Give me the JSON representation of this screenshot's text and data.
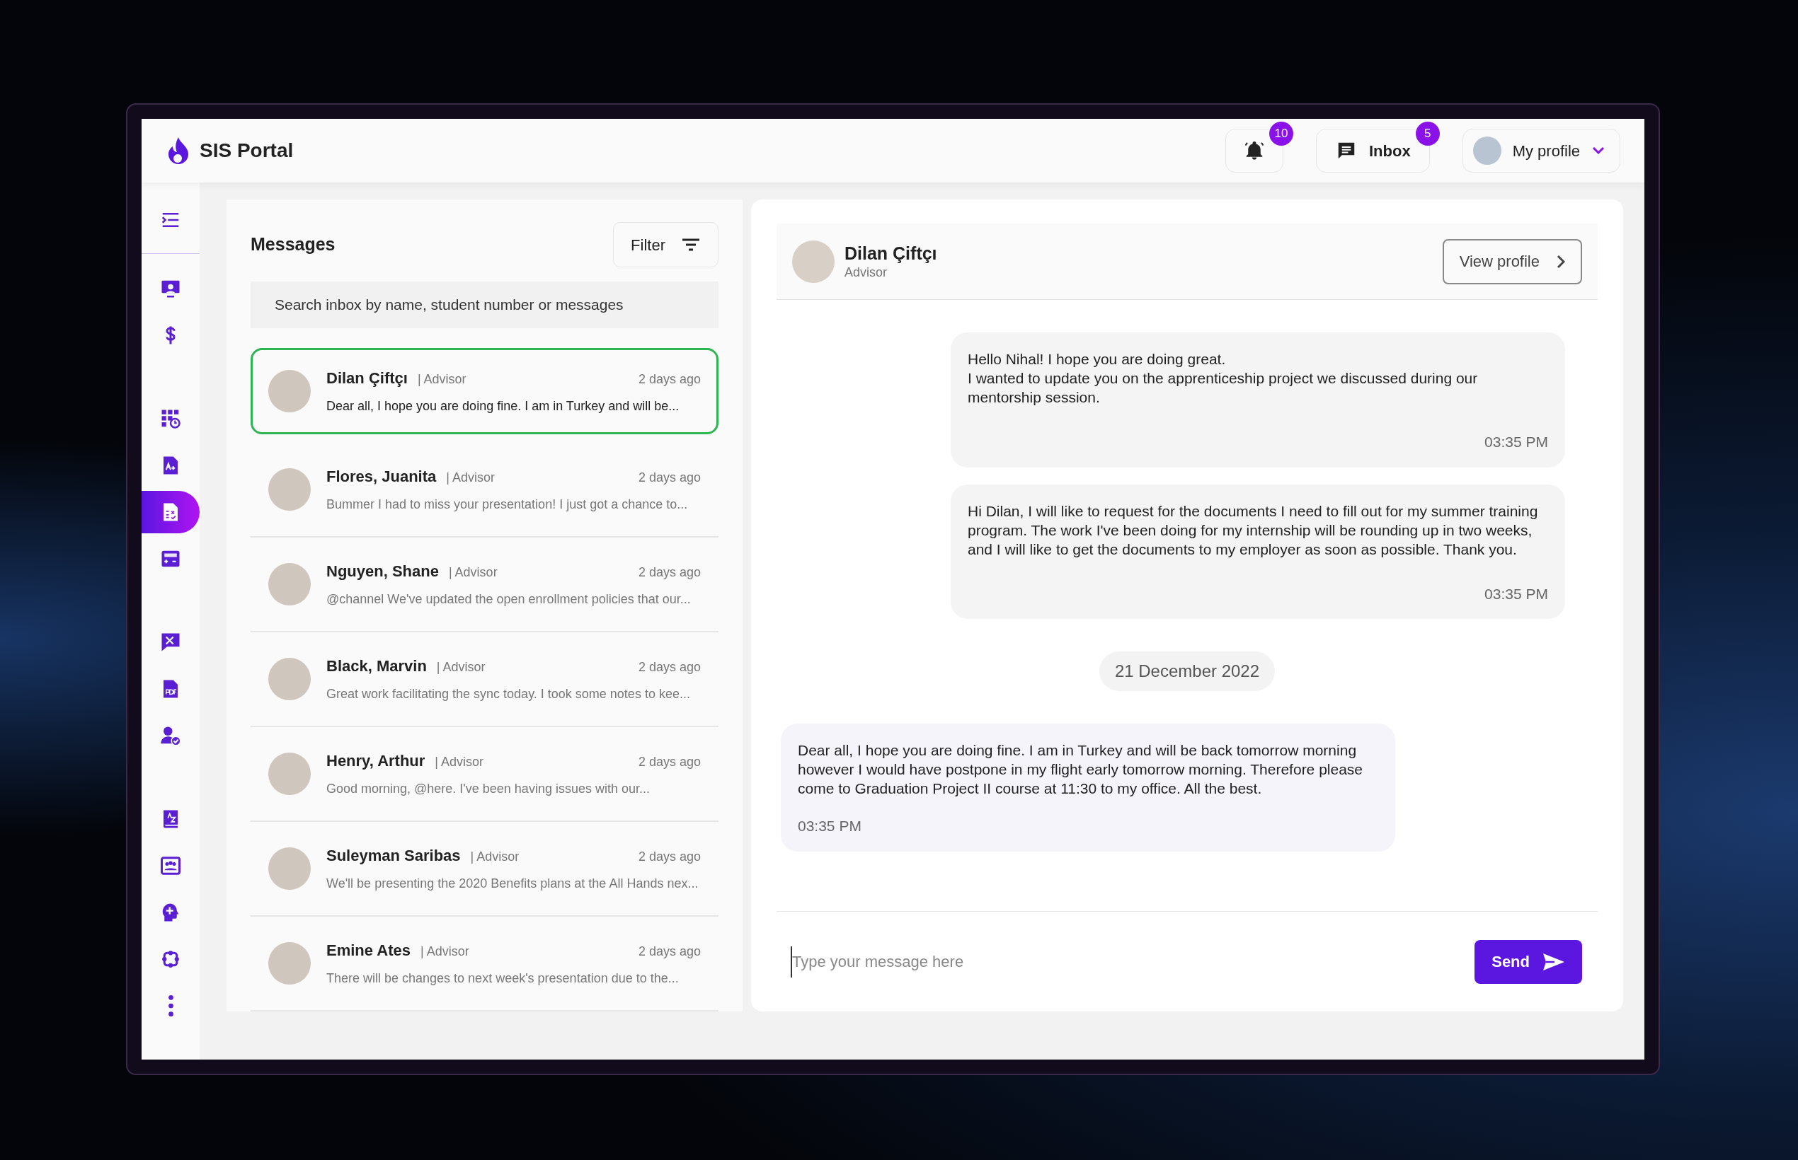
{
  "header": {
    "title": "SIS Portal",
    "notifications": {
      "count": "10"
    },
    "inbox": {
      "label": "Inbox",
      "count": "5"
    },
    "profile": {
      "label": "My profile"
    }
  },
  "sidebar": {
    "groups": [
      [
        {
          "selected": false
        }
      ],
      [
        {
          "selected": false
        },
        {
          "selected": false
        }
      ],
      [
        {
          "selected": false
        },
        {
          "selected": false
        },
        {
          "selected": true
        },
        {
          "selected": false
        }
      ],
      [
        {
          "selected": false
        },
        {
          "selected": false
        },
        {
          "selected": false
        }
      ],
      [
        {
          "selected": false
        },
        {
          "selected": false
        },
        {
          "selected": false
        },
        {
          "selected": false
        },
        {
          "selected": false
        }
      ]
    ]
  },
  "messages": {
    "title": "Messages",
    "filter": "Filter",
    "search": {
      "placeholder": "Search inbox by name, student number or messages"
    },
    "items": [
      {
        "name": "Dilan Çiftçı",
        "role": "| Advisor",
        "time": "2 days ago",
        "preview": "Dear all, I hope you are doing fine. I am in Turkey and will be...",
        "selected": true
      },
      {
        "name": "Flores, Juanita",
        "role": "| Advisor",
        "time": "2 days ago",
        "preview": "Bummer I had to miss your presentation! I just got a chance to...",
        "selected": false
      },
      {
        "name": "Nguyen, Shane",
        "role": "| Advisor",
        "time": "2 days ago",
        "preview": "@channel We've updated the open enrollment policies that our...",
        "selected": false
      },
      {
        "name": "Black, Marvin",
        "role": "| Advisor",
        "time": "2 days ago",
        "preview": "Great work facilitating the sync today. I took some notes to kee...",
        "selected": false
      },
      {
        "name": "Henry, Arthur",
        "role": "| Advisor",
        "time": "2 days ago",
        "preview": "Good morning, @here. I've been having issues with our...",
        "selected": false
      },
      {
        "name": "Suleyman Saribas",
        "role": "| Advisor",
        "time": "2 days ago",
        "preview": "We'll be presenting the 2020 Benefits plans at the All Hands nex...",
        "selected": false
      },
      {
        "name": "Emine Ates",
        "role": "| Advisor",
        "time": "2 days ago",
        "preview": "There will be changes to next week's presentation due to the...",
        "selected": false
      }
    ]
  },
  "chat": {
    "contact": {
      "name": "Dilan Çiftçı",
      "role": "Advisor"
    },
    "view_profile": "View profile",
    "items": [
      {
        "kind": "outgoing",
        "text": "Hello Nihal! I hope you are doing great.\nI wanted to update you on the apprenticeship project we discussed during our mentorship session.",
        "time": "03:35 PM"
      },
      {
        "kind": "outgoing",
        "text": "Hi Dilan, I will like to request for the documents I need to fill out for my summer training program. The work I've been doing for my internship will be rounding up in two weeks, and I will like to get the documents to my employer as soon as possible. Thank you.",
        "time": "03:35 PM"
      },
      {
        "kind": "date",
        "text": "21 December 2022"
      },
      {
        "kind": "incoming",
        "text": "Dear all, I hope you are doing fine. I am in Turkey and will be back tomorrow morning however I would have postpone in my flight early tomorrow morning. Therefore please come to Graduation Project II course at 11:30 to my office. All the best.",
        "time": "03:35 PM"
      }
    ],
    "composer": {
      "placeholder": "Type your message here",
      "send": "Send"
    }
  }
}
